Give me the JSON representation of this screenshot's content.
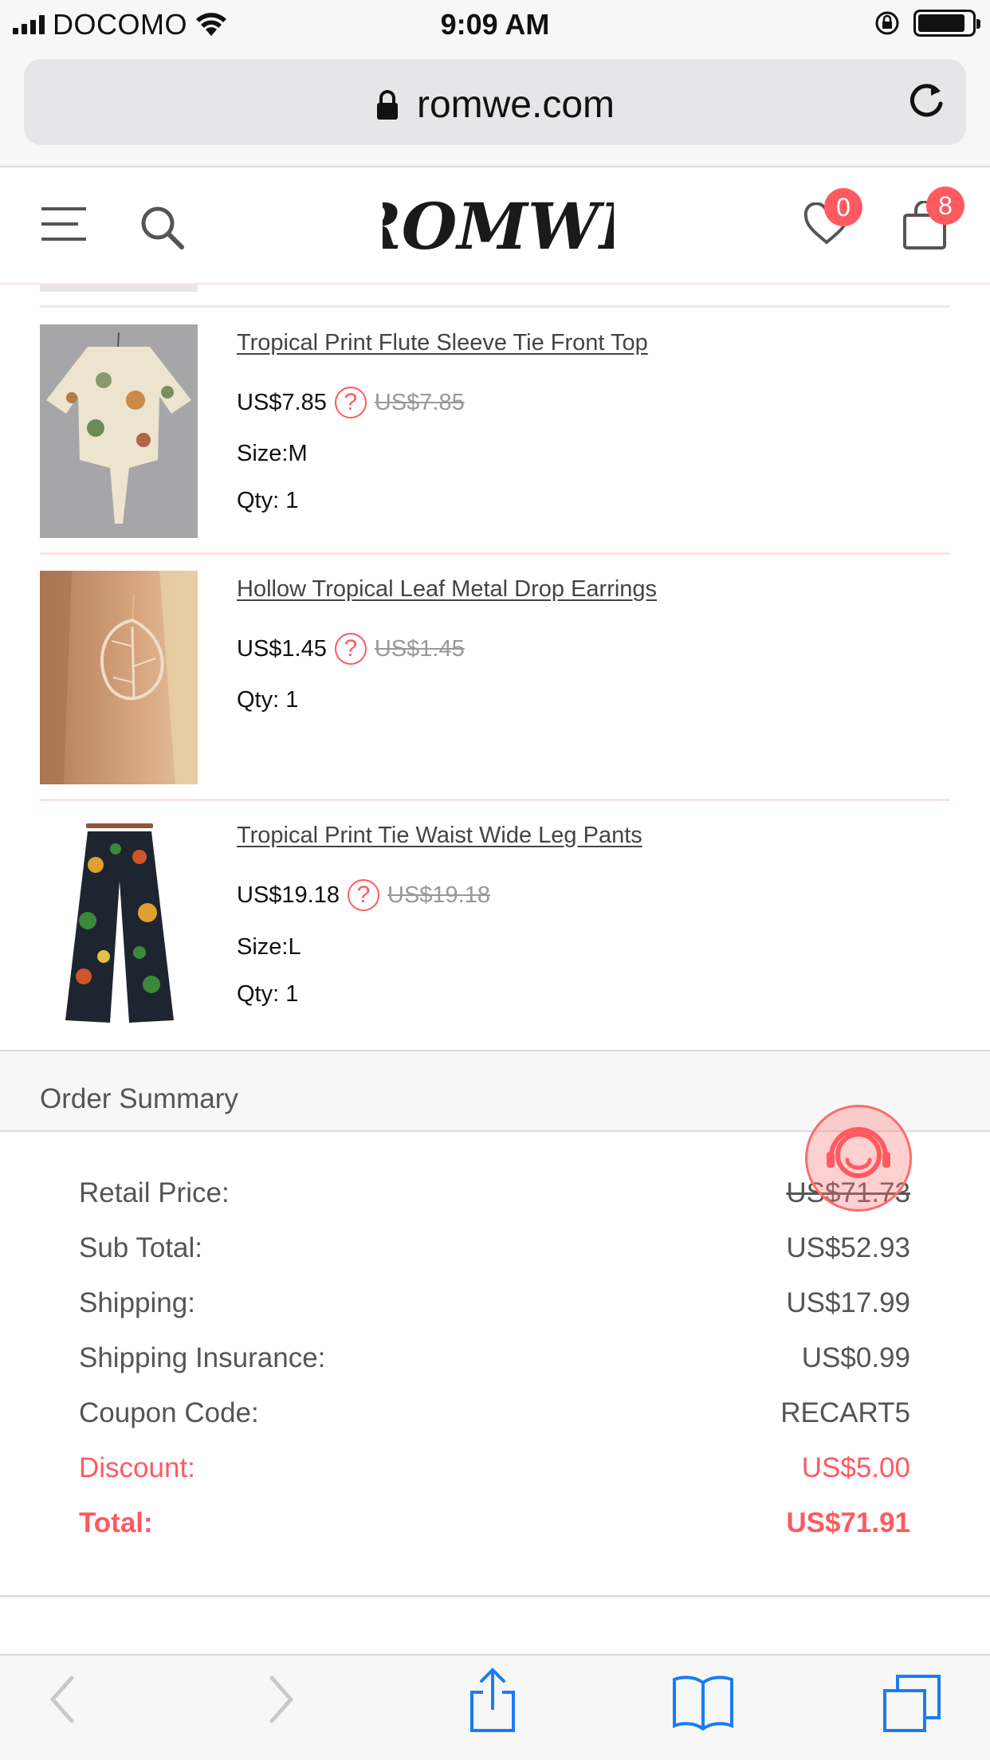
{
  "status_bar": {
    "carrier": "DOCOMO",
    "time": "9:09 AM"
  },
  "browser": {
    "url": "romwe.com"
  },
  "header": {
    "logo_text": "ROMWE",
    "wishlist_count": "0",
    "cart_count": "8"
  },
  "cart_items": [
    {
      "name": "Tropical Print Flute Sleeve Tie Front Top",
      "price": "US$7.85",
      "original_price": "US$7.85",
      "size": "Size:M",
      "qty": "Qty: 1"
    },
    {
      "name": "Hollow Tropical Leaf Metal Drop Earrings",
      "price": "US$1.45",
      "original_price": "US$1.45",
      "qty": "Qty: 1"
    },
    {
      "name": "Tropical Print Tie Waist Wide Leg Pants",
      "price": "US$19.18",
      "original_price": "US$19.18",
      "size": "Size:L",
      "qty": "Qty: 1"
    }
  ],
  "summary": {
    "title": "Order Summary",
    "rows": [
      {
        "label": "Retail Price:",
        "value": "US$71.73"
      },
      {
        "label": "Sub Total:",
        "value": "US$52.93"
      },
      {
        "label": "Shipping:",
        "value": "US$17.99"
      },
      {
        "label": "Shipping Insurance:",
        "value": "US$0.99"
      },
      {
        "label": "Coupon Code:",
        "value": "RECART5"
      },
      {
        "label": "Discount:",
        "value": "US$5.00"
      },
      {
        "label": "Total:",
        "value": "US$71.91"
      }
    ]
  },
  "colors": {
    "accent": "#ff5a5f",
    "text": "#555555",
    "ios_blue": "#1a7cf5"
  },
  "icons": [
    "signal-icon",
    "wifi-icon",
    "orientation-lock-icon",
    "battery-icon",
    "lock-icon",
    "reload-icon",
    "menu-icon",
    "search-icon",
    "heart-icon",
    "bag-icon",
    "help-icon",
    "support-icon",
    "back-icon",
    "forward-icon",
    "share-icon",
    "bookmarks-icon",
    "tabs-icon"
  ]
}
